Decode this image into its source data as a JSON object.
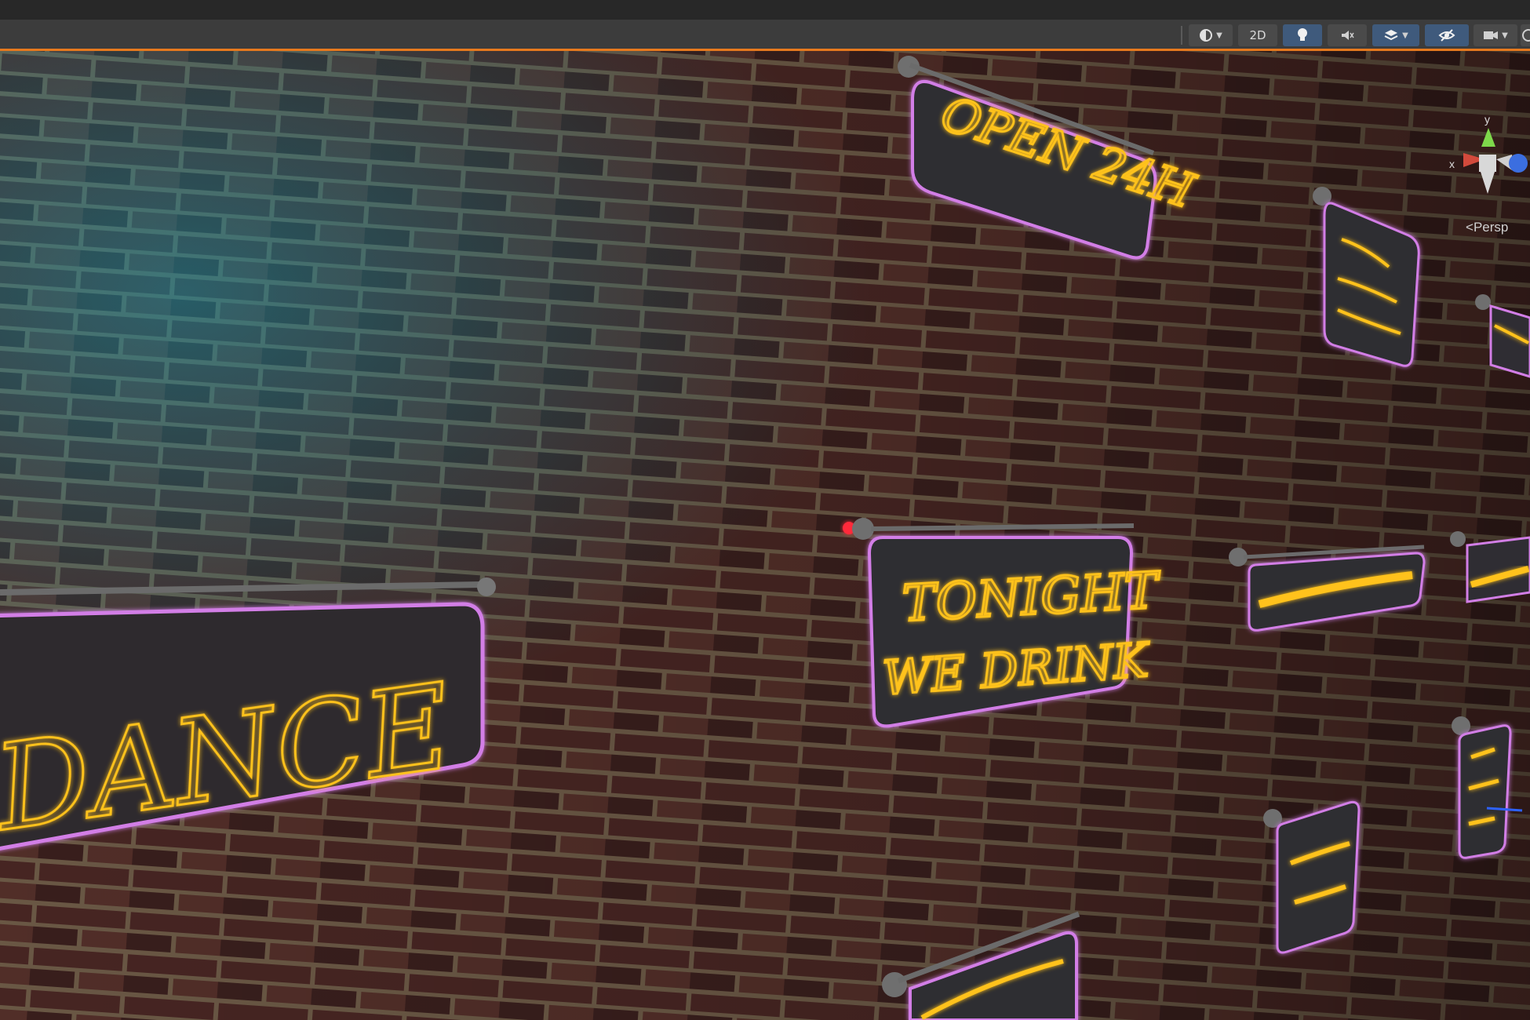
{
  "toolbar": {
    "shading_icon": "sphere-shading-icon",
    "mode_2d": "2D",
    "lighting_icon": "lightbulb-icon",
    "audio_icon": "audio-mute-icon",
    "effects_icon": "effects-layers-icon",
    "visibility_icon": "hidden-eye-icon",
    "camera_icon": "camera-icon",
    "gizmos_icon": "gizmo-globe-icon"
  },
  "viewport": {
    "projection_label": "Persp",
    "axis_x": "x",
    "axis_y": "y"
  },
  "colors": {
    "accent": "#e6791e",
    "neon_yellow": "#ffc21a",
    "neon_pink": "#d27ee6",
    "brick": "#4a2623",
    "mortar": "#7a6852"
  }
}
